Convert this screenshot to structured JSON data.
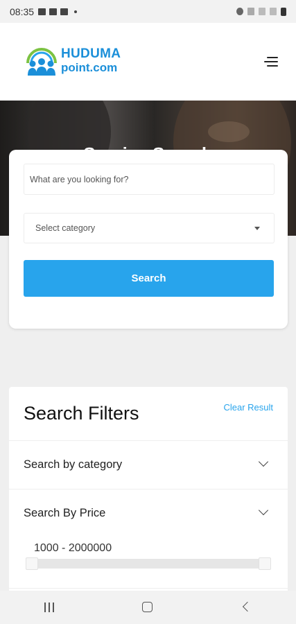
{
  "status_bar": {
    "time": "08:35",
    "icons": [
      "gallery-icon",
      "message-icon",
      "chat-icon",
      "dot-icon",
      "alarm-icon",
      "wifi-calling-icon",
      "signal-icon",
      "signal-icon",
      "battery-icon"
    ]
  },
  "header": {
    "logo_line1": "HUDUMA",
    "logo_line2": "point.com",
    "menu_icon": "menu-icon"
  },
  "hero": {
    "title": "Service Search"
  },
  "search": {
    "placeholder": "What are you looking for?",
    "category_label": "Select category",
    "button_label": "Search"
  },
  "filters": {
    "title": "Search Filters",
    "clear_label": "Clear Result",
    "sections": [
      {
        "label": "Search by category"
      },
      {
        "label": "Search By Price"
      }
    ],
    "price_range_text": "1000 - 2000000",
    "price_min": 1000,
    "price_max": 2000000
  },
  "nav_bar": {
    "buttons": [
      "recents-icon",
      "home-icon",
      "back-icon"
    ]
  },
  "colors": {
    "accent": "#28a4ec",
    "logo": "#1b8fd9"
  }
}
